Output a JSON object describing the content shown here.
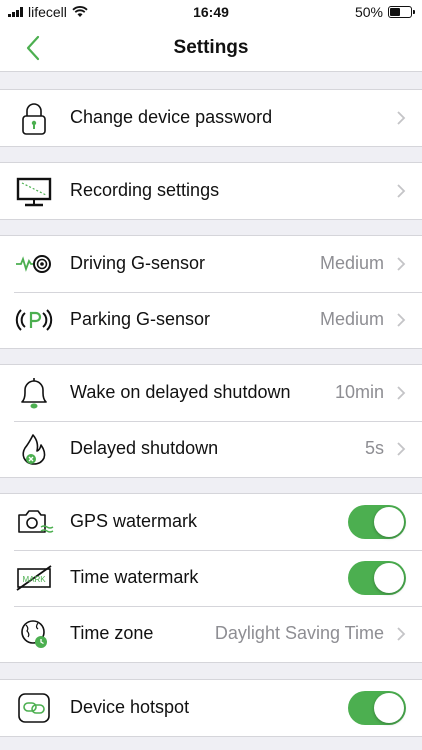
{
  "status_bar": {
    "carrier": "lifecell",
    "time": "16:49",
    "battery": "50%",
    "battery_level": 0.5
  },
  "header": {
    "title": "Settings",
    "back_icon": "chevron-left-icon"
  },
  "colors": {
    "accent": "#4caf50",
    "background": "#efeff4",
    "value_text": "#8e8e93"
  },
  "groups": [
    {
      "items": [
        {
          "icon": "lock-icon",
          "label": "Change device password",
          "value": "",
          "control": "chevron"
        }
      ]
    },
    {
      "items": [
        {
          "icon": "monitor-icon",
          "label": "Recording settings",
          "value": "",
          "control": "chevron"
        }
      ]
    },
    {
      "items": [
        {
          "icon": "g-sensor-icon",
          "label": "Driving G-sensor",
          "value": "Medium",
          "control": "chevron"
        },
        {
          "icon": "parking-icon",
          "label": "Parking G-sensor",
          "value": "Medium",
          "control": "chevron"
        }
      ]
    },
    {
      "items": [
        {
          "icon": "bell-icon",
          "label": "Wake on delayed shutdown",
          "value": "10min",
          "control": "chevron"
        },
        {
          "icon": "flame-icon",
          "label": "Delayed shutdown",
          "value": "5s",
          "control": "chevron"
        }
      ]
    },
    {
      "items": [
        {
          "icon": "camera-icon",
          "label": "GPS watermark",
          "value": "",
          "control": "toggle",
          "on": true
        },
        {
          "icon": "watermark-icon",
          "label": "Time watermark",
          "value": "",
          "control": "toggle",
          "on": true,
          "icon_text": "MARK"
        },
        {
          "icon": "globe-clock-icon",
          "label": "Time zone",
          "value": "Daylight Saving Time",
          "control": "chevron"
        }
      ]
    },
    {
      "items": [
        {
          "icon": "hotspot-icon",
          "label": "Device hotspot",
          "value": "",
          "control": "toggle",
          "on": true
        }
      ]
    }
  ]
}
